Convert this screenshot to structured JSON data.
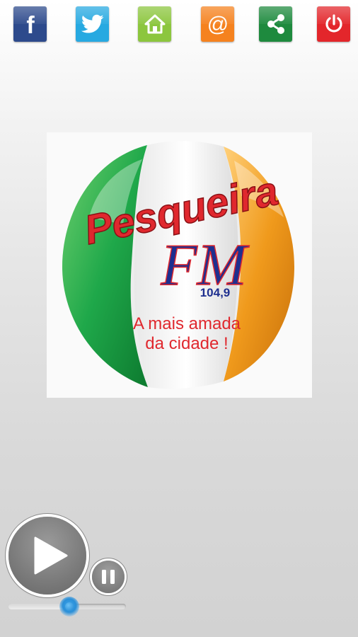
{
  "toolbar": {
    "buttons": [
      {
        "name": "facebook-button",
        "icon": "facebook-icon",
        "color": "#2d4a8c"
      },
      {
        "name": "twitter-button",
        "icon": "twitter-bird-icon",
        "color": "#27a9e1"
      },
      {
        "name": "home-button",
        "icon": "home-icon",
        "color": "#8cc63e"
      },
      {
        "name": "email-button",
        "icon": "at-sign-icon",
        "color": "#f5821f"
      },
      {
        "name": "share-button",
        "icon": "share-icon",
        "color": "#1e8a3e"
      },
      {
        "name": "power-button",
        "icon": "power-icon",
        "color": "#e3262b"
      }
    ]
  },
  "logo": {
    "name_text": "Pesqueira",
    "fm_text": "FM",
    "frequency": "104,9",
    "slogan_line1": "A mais amada",
    "slogan_line2": "da cidade !",
    "colors": {
      "green": "#1fa84a",
      "white": "#f4f4f4",
      "orange": "#f09a1c",
      "red": "#e0282e",
      "blue": "#1e2f8f"
    }
  },
  "player": {
    "play_icon": "play-icon",
    "pause_icon": "pause-icon",
    "volume_level": 0.52,
    "accent": "#2a8fd8"
  }
}
